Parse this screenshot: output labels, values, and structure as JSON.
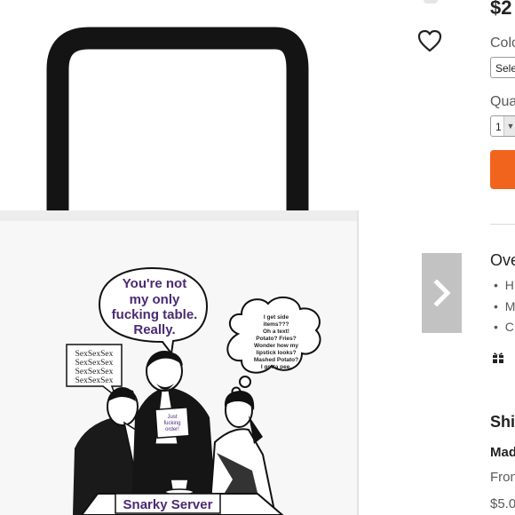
{
  "product": {
    "price": "$2",
    "color_label": "Colo",
    "color_select_value": "Sele",
    "quantity_label": "Qua",
    "quantity_value": "1",
    "overview_label": "Ove",
    "overview_bullets": [
      "H",
      "M",
      "C"
    ],
    "shipping_label": "Shi",
    "made_label": "Mad",
    "from_label": "Fron",
    "shipping_cost": "$5.0"
  },
  "artwork": {
    "speech_bubble": [
      "You're not",
      "my only",
      "fucking table.",
      "Really."
    ],
    "thought_bubble": [
      "I get side",
      "items???",
      "Oh a text!",
      "Potato? Fries?",
      "Wonder how my",
      "lipstick looks?",
      "Mashed Potato?",
      "I gotta pee."
    ],
    "sex_bubble": [
      "SexSexSex",
      "SexSexSex",
      "SexSexSex",
      "SexSexSex"
    ],
    "order_pad": [
      "Just",
      "fucking",
      "order!"
    ],
    "banner": "Snarky Server"
  },
  "colors": {
    "cart_button": "#f1641e",
    "arrow_bg": "#c2c2c2",
    "text_purple": "#4b2a73"
  },
  "icons": {
    "favorite": "heart-icon",
    "next": "chevron-right-icon",
    "gift": "gift-icon"
  }
}
